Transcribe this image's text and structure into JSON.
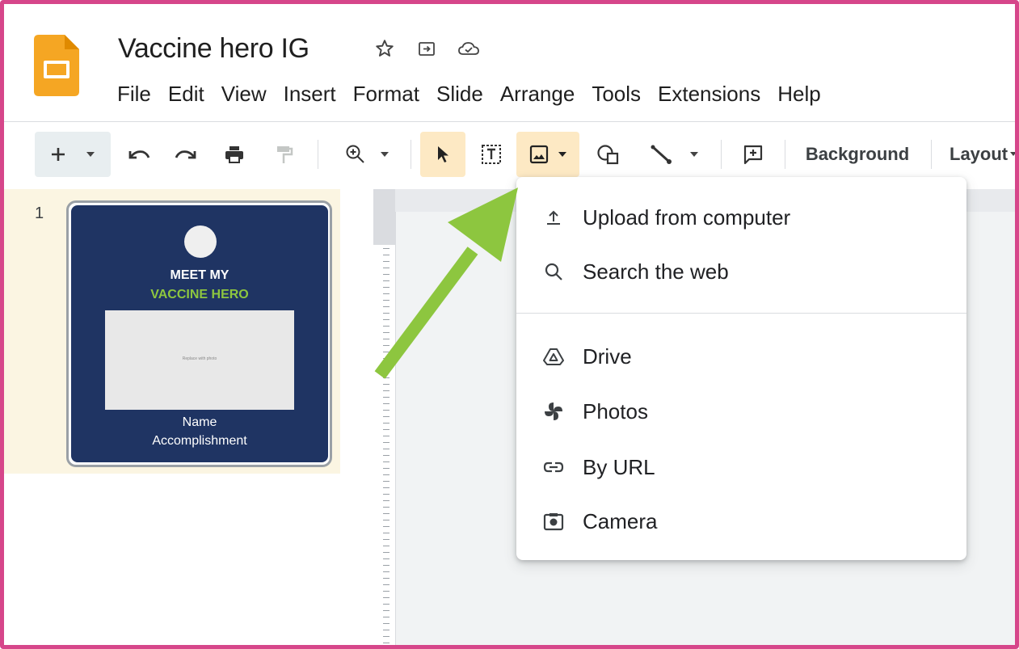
{
  "document": {
    "title": "Vaccine hero IG"
  },
  "menu_bar": [
    "File",
    "Edit",
    "View",
    "Insert",
    "Format",
    "Slide",
    "Arrange",
    "Tools",
    "Extensions",
    "Help"
  ],
  "toolbar": {
    "background_label": "Background",
    "layout_label": "Layout"
  },
  "slide_panel": {
    "slide_number": "1",
    "thumbnail": {
      "line1": "MEET MY",
      "line2": "VACCINE HERO",
      "placeholder": "Replace with photo",
      "name": "Name",
      "accomplishment": "Accomplishment"
    }
  },
  "image_menu": {
    "items": [
      {
        "label": "Upload from computer",
        "icon": "upload-icon"
      },
      {
        "label": "Search the web",
        "icon": "search-icon"
      },
      {
        "label": "Drive",
        "icon": "drive-icon"
      },
      {
        "label": "Photos",
        "icon": "photos-icon"
      },
      {
        "label": "By URL",
        "icon": "link-icon"
      },
      {
        "label": "Camera",
        "icon": "camera-icon"
      }
    ]
  },
  "colors": {
    "frame_border": "#d6468a",
    "highlight": "#fde9c4",
    "arrow": "#8dc63f",
    "slide_bg": "#1f3463",
    "slides_logo": "#f5a623"
  }
}
